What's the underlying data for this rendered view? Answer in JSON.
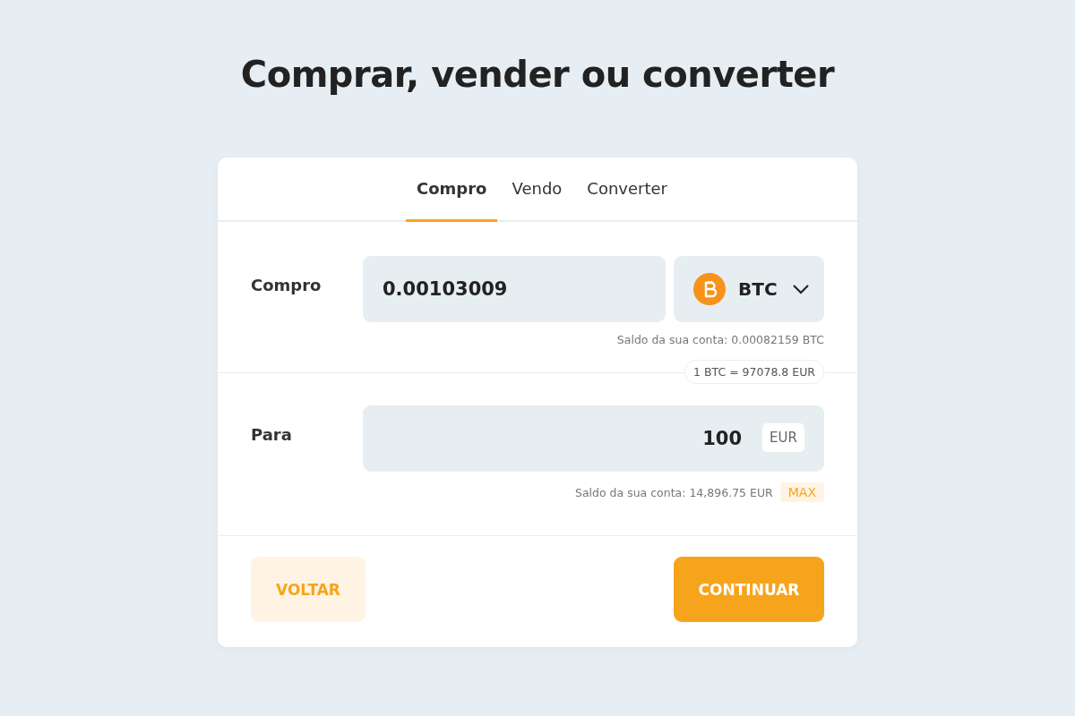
{
  "title": "Comprar, vender ou converter",
  "tabs": [
    {
      "label": "Compro",
      "selected": true
    },
    {
      "label": "Vendo",
      "selected": false
    },
    {
      "label": "Converter",
      "selected": false
    }
  ],
  "from": {
    "label": "Compro",
    "value": "0.00103009",
    "currency": "BTC",
    "balance": "Saldo da sua conta: 0.00082159 BTC"
  },
  "rate": "1 BTC = 97078.8 EUR",
  "to": {
    "label": "Para",
    "value": "100",
    "currency": "EUR",
    "balance": "Saldo da sua conta: 14,896.75 EUR",
    "max": "MAX"
  },
  "buttons": [
    {
      "label": "VOLTAR",
      "kind": "secondary"
    },
    {
      "label": "CONTINUAR",
      "kind": "primary"
    }
  ]
}
